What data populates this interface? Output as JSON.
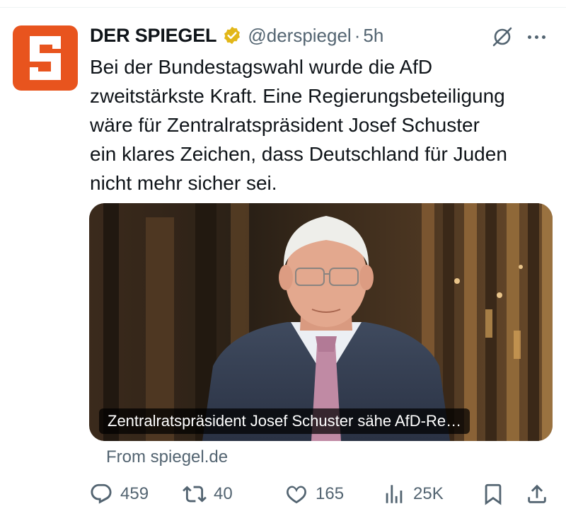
{
  "post": {
    "author": {
      "display_name": "DER SPIEGEL",
      "handle": "@derspiegel",
      "separator": "·",
      "time": "5h",
      "verified": true,
      "avatar_letter": "S",
      "avatar_color": "#e8541e"
    },
    "text_lines": [
      "Bei der Bundestagswahl wurde die AfD",
      "zweitstärkste Kraft. Eine Regierungsbeteiligung",
      "wäre für Zentralratspräsident Josef Schuster",
      "ein klares Zeichen, dass Deutschland für Juden",
      "nicht mehr sicher sei."
    ],
    "media": {
      "caption": "Zentralratspräsident Josef Schuster sähe AfD-Re…"
    },
    "source": "From spiegel.de",
    "stats": {
      "replies": "459",
      "reposts": "40",
      "likes": "165",
      "views": "25K"
    }
  },
  "icons": {
    "verified": "verified-badge-icon",
    "grok": "grok-icon",
    "more": "more-icon",
    "reply": "reply-icon",
    "repost": "repost-icon",
    "like": "like-icon",
    "views": "views-icon",
    "bookmark": "bookmark-icon",
    "share": "share-icon"
  },
  "colors": {
    "text": "#0f1419",
    "secondary": "#536471",
    "verified_gold": "#e2b719",
    "brand": "#e8541e"
  }
}
